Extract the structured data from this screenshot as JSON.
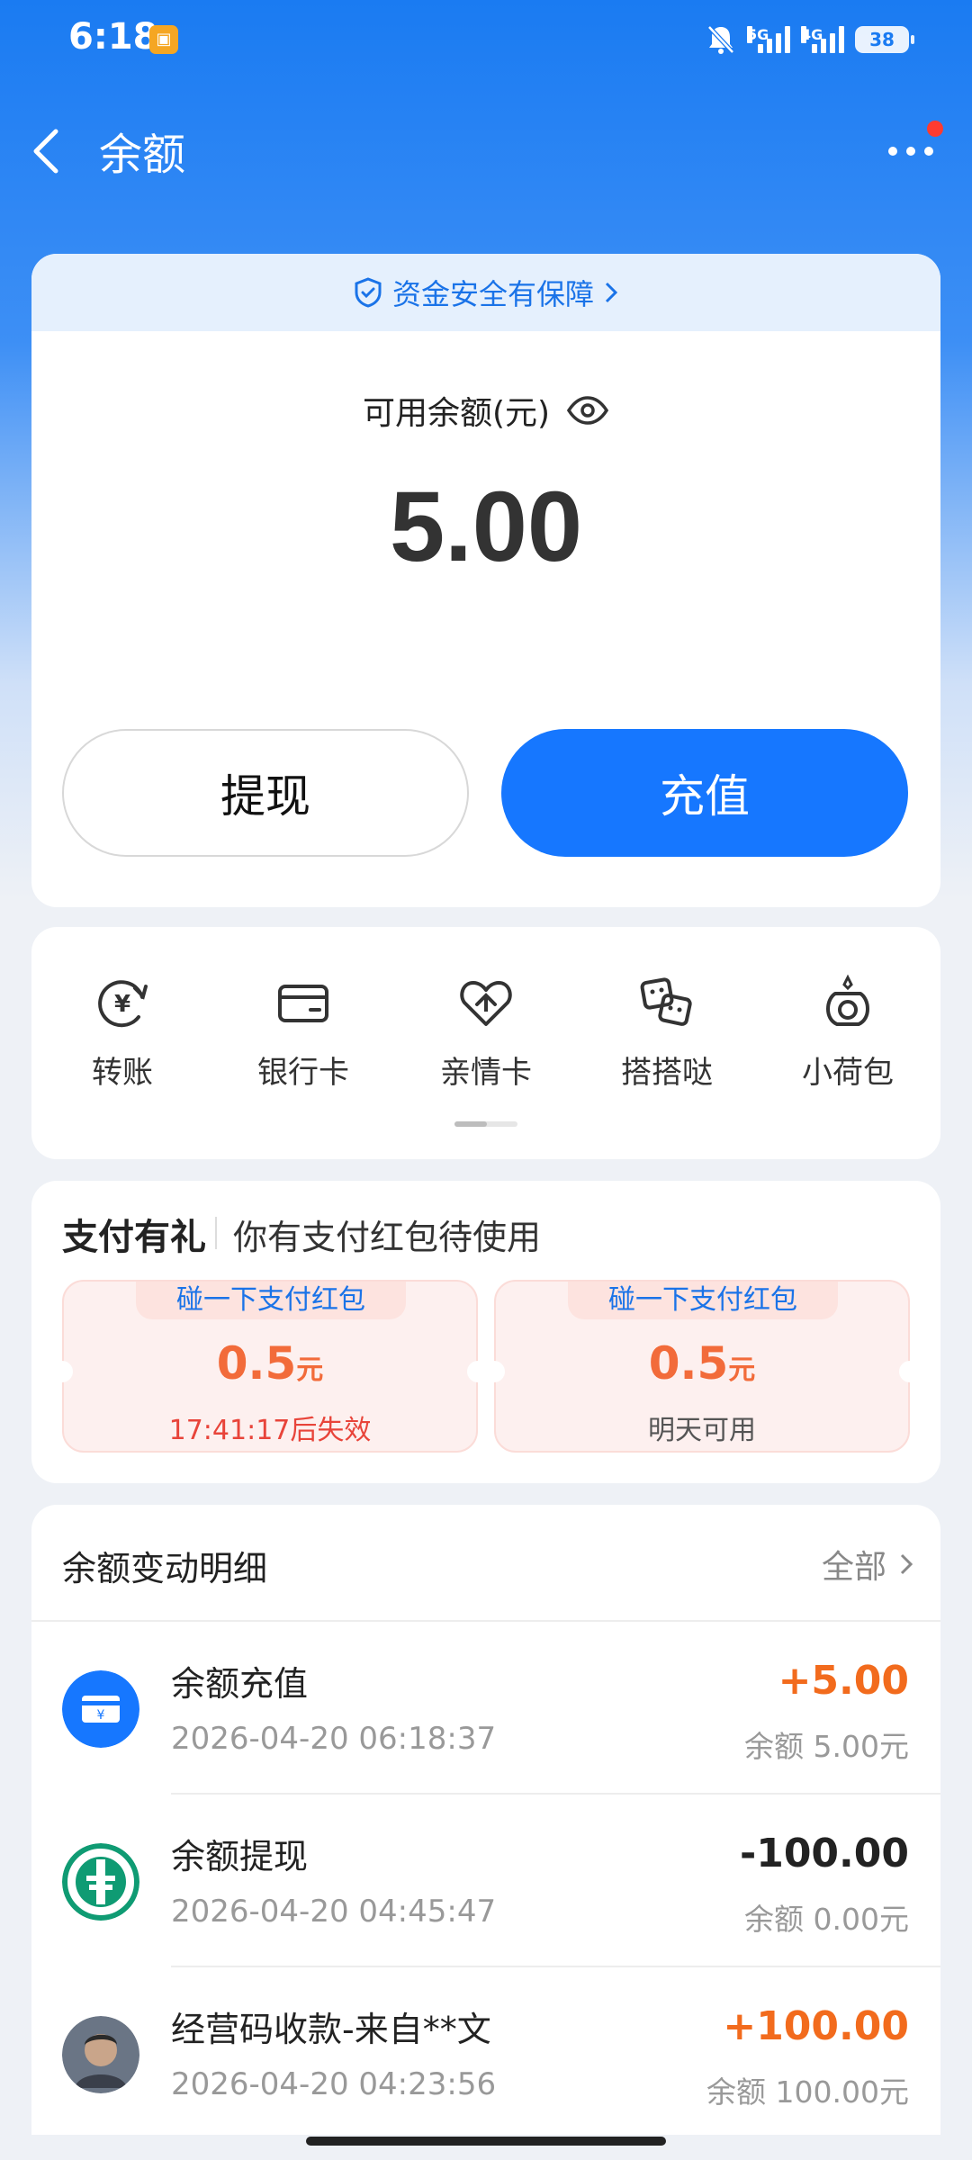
{
  "status_bar": {
    "time": "6:18",
    "network_1": "5G",
    "network_2": "4G",
    "battery": "38"
  },
  "header": {
    "title": "余额"
  },
  "balance_card": {
    "security_text": "资金安全有保障",
    "balance_label": "可用余额(元)",
    "balance_amount": "5.00",
    "withdraw_label": "提现",
    "recharge_label": "充值"
  },
  "quick_actions": [
    {
      "label": "转账",
      "icon": "transfer-yen-icon"
    },
    {
      "label": "银行卡",
      "icon": "bank-card-icon"
    },
    {
      "label": "亲情卡",
      "icon": "family-card-icon"
    },
    {
      "label": "搭搭哒",
      "icon": "dadada-icon"
    },
    {
      "label": "小荷包",
      "icon": "purse-icon"
    }
  ],
  "promo": {
    "title": "支付有礼",
    "subtitle": "你有支付红包待使用",
    "coupons": [
      {
        "tag": "碰一下支付红包",
        "amount": "0.5",
        "unit": "元",
        "note": "17:41:17后失效"
      },
      {
        "tag": "碰一下支付红包",
        "amount": "0.5",
        "unit": "元",
        "note": "明天可用"
      }
    ]
  },
  "transactions": {
    "header": "余额变动明细",
    "all_label": "全部",
    "items": [
      {
        "title": "余额充值",
        "date": "2026-04-20 06:18:37",
        "amount": "+5.00",
        "balance": "余额 5.00元",
        "avatar": "recharge-card-icon"
      },
      {
        "title": "余额提现",
        "date": "2026-04-20 04:45:47",
        "amount": "-100.00",
        "balance": "余额 0.00元",
        "avatar": "abc-bank-logo-icon"
      },
      {
        "title": "经营码收款-来自**文",
        "date": "2026-04-20 04:23:56",
        "amount": "+100.00",
        "balance": "余额 100.00元",
        "avatar": "user-avatar"
      }
    ]
  },
  "colors": {
    "brand_blue": "#1677ff",
    "positive_amount": "#f26b1d",
    "coupon_amount": "#f26b3a",
    "expire_red": "#e8443a"
  }
}
